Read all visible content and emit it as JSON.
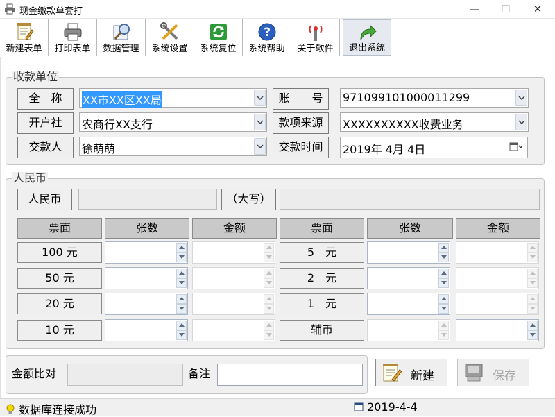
{
  "window": {
    "title": "现金缴款单套打"
  },
  "toolbar": [
    {
      "label": "新建表单",
      "icon": "new-form-icon"
    },
    {
      "label": "打印表单",
      "icon": "printer-icon"
    },
    {
      "label": "数据管理",
      "icon": "data-manage-icon"
    },
    {
      "label": "系统设置",
      "icon": "tools-icon"
    },
    {
      "label": "系统复位",
      "icon": "refresh-icon"
    },
    {
      "label": "系统帮助",
      "icon": "help-icon"
    },
    {
      "label": "关于软件",
      "icon": "antenna-icon"
    },
    {
      "label": "退出系统",
      "icon": "exit-arrow-icon"
    }
  ],
  "payee": {
    "legend": "收款单位",
    "name_label": "全　称",
    "name_value": "XX市XX区XX局",
    "bank_label": "开户社",
    "bank_value": "农商行XX支行",
    "payer_label": "交款人",
    "payer_value": "徐萌萌",
    "account_label": "账　　号",
    "account_value": "971099101000011299",
    "source_label": "款项来源",
    "source_value": "XXXXXXXXXX收费业务",
    "date_label": "交款时间",
    "date_value": "2019年  4月  4日"
  },
  "rmb": {
    "legend": "人民币",
    "label": "人民币",
    "daxie_label": "（大写）",
    "headers": [
      "票面",
      "张数",
      "金额",
      "票面",
      "张数",
      "金额"
    ],
    "left_denoms": [
      "100  元",
      "50  元",
      "20  元",
      "10  元"
    ],
    "right_denoms": [
      "5　元",
      "2　元",
      "1　元",
      "辅币"
    ]
  },
  "compare": {
    "label": "金额比对",
    "remark_label": "备注"
  },
  "buttons": {
    "new": "新建",
    "save": "保存"
  },
  "status": {
    "message": "数据库连接成功",
    "date": "2019-4-4"
  }
}
